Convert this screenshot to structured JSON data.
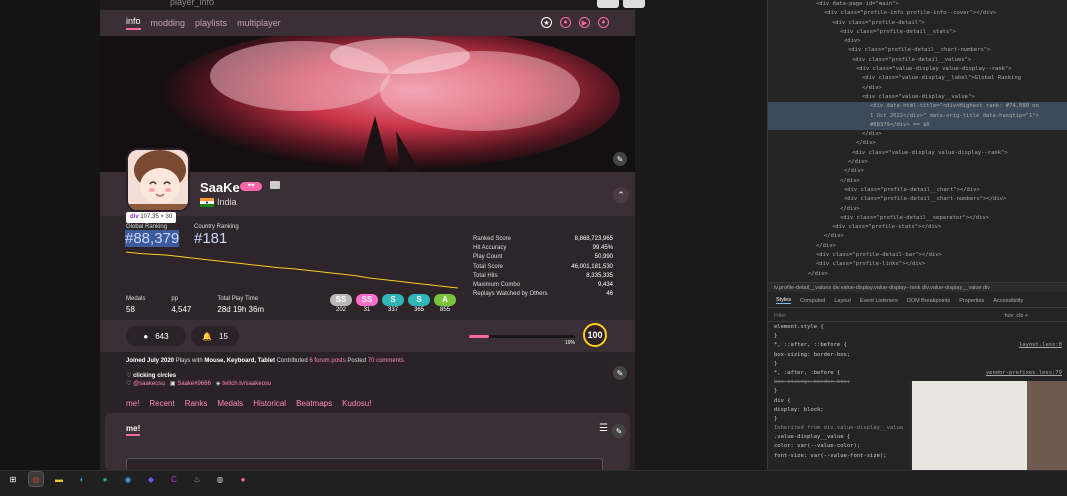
{
  "page": {
    "crumb": "player_info",
    "tabs": [
      {
        "label": "info",
        "active": true
      },
      {
        "label": "modding",
        "active": false
      },
      {
        "label": "playlists",
        "active": false
      },
      {
        "label": "multiplayer",
        "active": false
      }
    ],
    "tab_icons": [
      "star-icon",
      "favourite-icon",
      "play-icon",
      "circle-icon"
    ]
  },
  "profile": {
    "username": "SaaKe",
    "supporter_icon": "heart-icon",
    "country": "India",
    "tooltip_tag": "div",
    "tooltip_size": "107.35 × 30",
    "global_rank_label": "Global Ranking",
    "global_rank": "#88,379",
    "country_rank_label": "Country Ranking",
    "country_rank": "#181",
    "medals_label": "Medals",
    "medals": "58",
    "pp_label": "pp",
    "pp": "4,547",
    "playtime_label": "Total Play Time",
    "playtime": "28d 19h 36m",
    "grades": [
      {
        "label": "SS",
        "count": "202",
        "color": "#b8b8b8"
      },
      {
        "label": "SS",
        "count": "31",
        "color": "#ff6ec7"
      },
      {
        "label": "S",
        "count": "337",
        "color": "#2fb5b5"
      },
      {
        "label": "S",
        "count": "365",
        "color": "#2fb5b5"
      },
      {
        "label": "A",
        "count": "855",
        "color": "#7bc43b"
      }
    ],
    "rank_history": [
      88,
      86,
      85,
      84,
      82,
      80,
      78,
      76,
      74,
      72,
      70,
      68,
      66,
      65,
      63,
      61,
      59,
      57,
      55,
      52,
      50,
      48,
      46,
      44,
      42,
      40,
      38
    ],
    "right_stats": [
      {
        "label": "Ranked Score",
        "value": "8,868,723,965"
      },
      {
        "label": "Hit Accuracy",
        "value": "99.45%"
      },
      {
        "label": "Play Count",
        "value": "50,990"
      },
      {
        "label": "Total Score",
        "value": "46,001,181,530"
      },
      {
        "label": "Total Hits",
        "value": "8,335,335"
      },
      {
        "label": "Maximum Combo",
        "value": "9,434"
      },
      {
        "label": "Replays Watched by Others",
        "value": "46"
      }
    ],
    "followers": "643",
    "mapping_subs": "15",
    "level_progress_pct": 19,
    "level_progress_text": "19%",
    "level": "100"
  },
  "info": {
    "joined": "Joined July 2020",
    "plays_with_prefix": "Plays with",
    "plays_with": "Mouse, Keyboard, Tablet",
    "contributed_prefix": "Contributed",
    "forum_posts": "6 forum posts",
    "posted_prefix": "Posted",
    "comments": "70 comments",
    "interest": "clicking circles",
    "twitter": "@saakeosu",
    "discord": "Saake#9666",
    "twitch": "twitch.tv/saakeosu"
  },
  "sub_nav": [
    "me!",
    "Recent",
    "Ranks",
    "Medals",
    "Historical",
    "Beatmaps",
    "Kudosu!"
  ],
  "me_title": "me!",
  "devtools": {
    "dom_lines": [
      "<div data-page-id=\"main\">",
      "<div class=\"profile-info profile-info--cover\"></div>",
      "<div class=\"profile-detail\">",
      "<div class=\"profile-detail__stats\">",
      "<div>",
      "<div class=\"profile-detail__chart-numbers\">",
      "<div class=\"profile-detail__values\">",
      "<div class=\"value-display value-display--rank\">",
      "<div class=\"value-display__label\">Global Ranking",
      "</div>",
      "<div class=\"value-display__value\">",
      "<div data-html-title=\"<div>Highest rank: #74,080 on",
      "1 Oct 2022</div>\" data-orig-title data-hasqtip=\"1\">",
      "#88379</div> == $0",
      "</div>",
      "</div>",
      "<div class=\"value-display value-display--rank\">",
      "</div>",
      "</div>",
      "</div>",
      "<div class=\"profile-detail__chart\"></div>",
      "<div class=\"profile-detail__chart-numbers\"></div>",
      "</div>",
      "<div class=\"profile-detail__separator\"></div>",
      "<div class=\"profile-stats\"></div>",
      "</div>",
      "</div>",
      "<div class=\"profile-detail-bar\"></div>",
      "<div class=\"profile-links\"></div>",
      "</div>"
    ],
    "breadcrumb": "iv.profile-detail__values   div.value-display.value-display--rank   div.value-display__value   div",
    "tabs": [
      "Styles",
      "Computed",
      "Layout",
      "Event Listeners",
      "DOM Breakpoints",
      "Properties",
      "Accessibility"
    ],
    "filter_placeholder": "Filter",
    "filter_right": ":hov  .cls  +",
    "css_lines": [
      {
        "text": "element.style {",
        "src": ""
      },
      {
        "text": "}",
        "src": ""
      },
      {
        "text": "*, ::after, ::before {",
        "src": "layout.less:8"
      },
      {
        "text": "  box-sizing: border-box;",
        "src": ""
      },
      {
        "text": "}",
        "src": ""
      },
      {
        "text": "*, :after, :before {",
        "src": "vendor-prefixes.less:79"
      },
      {
        "text": "  box-sizing: border-box;",
        "src": ""
      },
      {
        "text": "}",
        "src": ""
      },
      {
        "text": "div {",
        "src": ""
      },
      {
        "text": "  display: block;",
        "src": ""
      },
      {
        "text": "}",
        "src": ""
      },
      {
        "text": "Inherited from div.value-display__value",
        "src": ""
      },
      {
        "text": ".value-display__value {",
        "src": ""
      },
      {
        "text": "  color: var(--value-color);",
        "src": ""
      },
      {
        "text": "  font-size: var(--value-font-size);",
        "src": ""
      }
    ]
  },
  "taskbar": {
    "icons": [
      "windows-icon",
      "chrome-icon",
      "file-explorer-icon",
      "edge-icon",
      "spotify-icon",
      "chrome-profile-icon",
      "discord-icon",
      "canva-icon",
      "steam-icon",
      "obs-icon",
      "osu-icon"
    ]
  }
}
